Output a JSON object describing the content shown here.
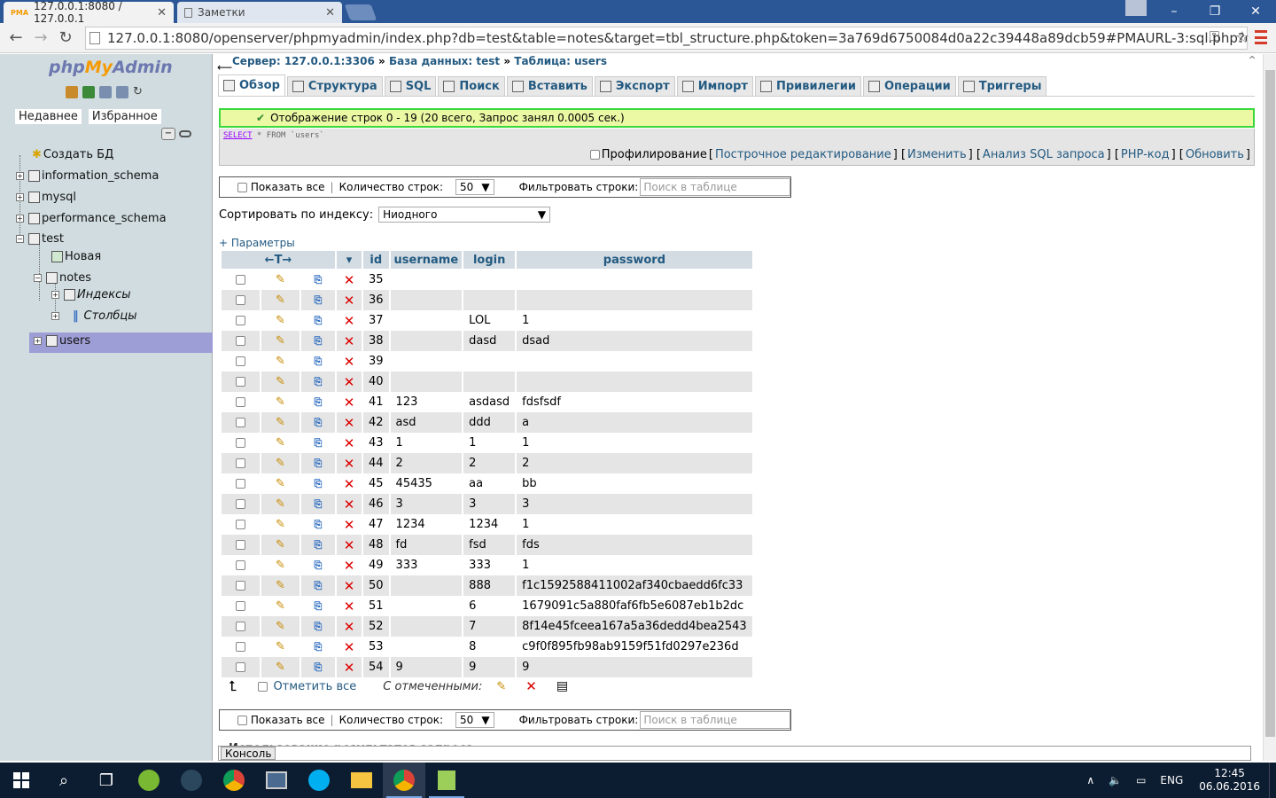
{
  "browser": {
    "tabs": [
      {
        "title": "127.0.0.1:8080 / 127.0.0.1",
        "favicon": "pma-icon"
      },
      {
        "title": "Заметки",
        "favicon": "page-icon"
      }
    ],
    "url": "127.0.0.1:8080/openserver/phpmyadmin/index.php?db=test&table=notes&target=tbl_structure.php&token=3a769d6750084d0a22c39448a89dcb59#PMAURL-3:sql.php?db=tes",
    "window_controls": [
      "–",
      "❐",
      "✕"
    ]
  },
  "sidebar": {
    "logo": {
      "php": "php",
      "my": "My",
      "admin": "Admin"
    },
    "tabs": [
      "Недавнее",
      "Избранное"
    ],
    "tree": {
      "create_db": "Создать БД",
      "information_schema": "information_schema",
      "mysql": "mysql",
      "performance_schema": "performance_schema",
      "test": "test",
      "new": "Новая",
      "notes": "notes",
      "indexes": "Индексы",
      "columns": "Столбцы",
      "users": "users"
    }
  },
  "breadcrumb": {
    "server": "Сервер: 127.0.0.1:3306",
    "database": "База данных: test",
    "table": "Таблица: users",
    "sep": "»"
  },
  "tabs": [
    "Обзор",
    "Структура",
    "SQL",
    "Поиск",
    "Вставить",
    "Экспорт",
    "Импорт",
    "Привилегии",
    "Операции",
    "Триггеры"
  ],
  "message": "Отображение строк 0 - 19 (20 всего, Запрос занял 0.0005 сек.)",
  "sql": {
    "select": "SELECT",
    "rest": " * FROM `users`"
  },
  "sql_options": {
    "profiling": "Профилирование",
    "links": [
      "Построчное редактирование",
      "Изменить",
      "Анализ SQL запроса",
      "PHP-код",
      "Обновить"
    ]
  },
  "navbar": {
    "show_all": "Показать все",
    "row_count_label": "Количество строк:",
    "row_count": "50",
    "filter_label": "Фильтровать строки:",
    "filter_placeholder": "Поиск в таблице"
  },
  "sort": {
    "label": "Сортировать по индексу:",
    "value": "Ниодного"
  },
  "params_link": "+ Параметры",
  "table": {
    "sort_arrows": "←T→",
    "columns": [
      "id",
      "username",
      "login",
      "password"
    ],
    "rows": [
      [
        "35",
        "",
        "",
        ""
      ],
      [
        "36",
        "",
        "",
        ""
      ],
      [
        "37",
        "",
        "LOL",
        "1"
      ],
      [
        "38",
        "",
        "dasd",
        "dsad"
      ],
      [
        "39",
        "",
        "",
        ""
      ],
      [
        "40",
        "",
        "",
        ""
      ],
      [
        "41",
        "123",
        "asdasd",
        "fdsfsdf"
      ],
      [
        "42",
        "asd",
        "ddd",
        "a"
      ],
      [
        "43",
        "1",
        "1",
        "1"
      ],
      [
        "44",
        "2",
        "2",
        "2"
      ],
      [
        "45",
        "45435",
        "aa",
        "bb"
      ],
      [
        "46",
        "3",
        "3",
        "3"
      ],
      [
        "47",
        "1234",
        "1234",
        "1"
      ],
      [
        "48",
        "fd",
        "fsd",
        "fds"
      ],
      [
        "49",
        "333",
        "333",
        "1"
      ],
      [
        "50",
        "",
        "888",
        "f1c1592588411002af340cbaedd6fc33"
      ],
      [
        "51",
        "",
        "6",
        "1679091c5a880faf6fb5e6087eb1b2dc"
      ],
      [
        "52",
        "",
        "7",
        "8f14e45fceea167a5a36dedd4bea2543"
      ],
      [
        "53",
        "",
        "8",
        "c9f0f895fb98ab9159f51fd0297e236d"
      ],
      [
        "54",
        "9",
        "9",
        "9"
      ]
    ]
  },
  "bottom": {
    "check_all": "Отметить все",
    "with_selected": "С отмеченными:"
  },
  "usage_title": "Использование результатов запроса",
  "console": "Консоль",
  "taskbar": {
    "lang": "ENG",
    "time": "12:45",
    "date": "06.06.2016"
  },
  "colors": {
    "accent": "#235a81",
    "success_border": "#3bd83b",
    "sidebar": "#d0dce0",
    "taskbar": "#0d1d31"
  }
}
